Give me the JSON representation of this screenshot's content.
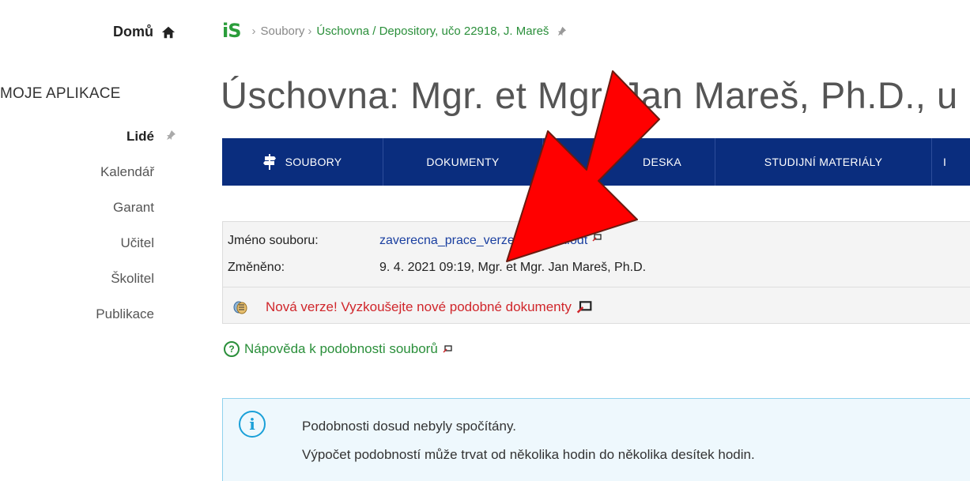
{
  "sidebar": {
    "home_label": "Domů",
    "section_title": "MOJE APLIKACE",
    "items": [
      {
        "label": "Lidé"
      },
      {
        "label": "Kalendář"
      },
      {
        "label": "Garant"
      },
      {
        "label": "Učitel"
      },
      {
        "label": "Školitel"
      },
      {
        "label": "Publikace"
      }
    ]
  },
  "breadcrumb": {
    "logo": "iS",
    "item1": "Soubory",
    "item2": "Úschovna / Depository, učo 22918, J. Mareš"
  },
  "page": {
    "title": "Úschovna: Mgr. et Mgr. Jan Mareš, Ph.D., u"
  },
  "tabs": [
    {
      "label": "SOUBORY"
    },
    {
      "label": "DOKUMENTY"
    },
    {
      "label": "DESKA"
    },
    {
      "label": "STUDIJNÍ MATERIÁLY"
    },
    {
      "label": "I"
    }
  ],
  "file": {
    "name_label": "Jméno souboru:",
    "name_value": "zaverecna_prace_verze_prosova.odt",
    "changed_label": "Změněno:",
    "changed_value": "9. 4. 2021 09:19, Mgr. et Mgr. Jan Mareš, Ph.D.",
    "new_version": "Nová verze! Vyzkoušejte nové podobné dokumenty"
  },
  "help": {
    "icon_text": "?",
    "label": "Nápověda k podobnosti souborů"
  },
  "notice": {
    "icon_text": "i",
    "line1": "Podobnosti dosud nebyly spočítány.",
    "line2": "Výpočet podobností může trvat od několika hodin do několika desítek hodin."
  },
  "colors": {
    "tabbar": "#0a2d7e",
    "link_green": "#2a8f3a",
    "link_blue": "#1a3fa0",
    "alert_red": "#d0262b",
    "arrow_red": "#ff0000",
    "notice_border": "#8fd2ee"
  }
}
